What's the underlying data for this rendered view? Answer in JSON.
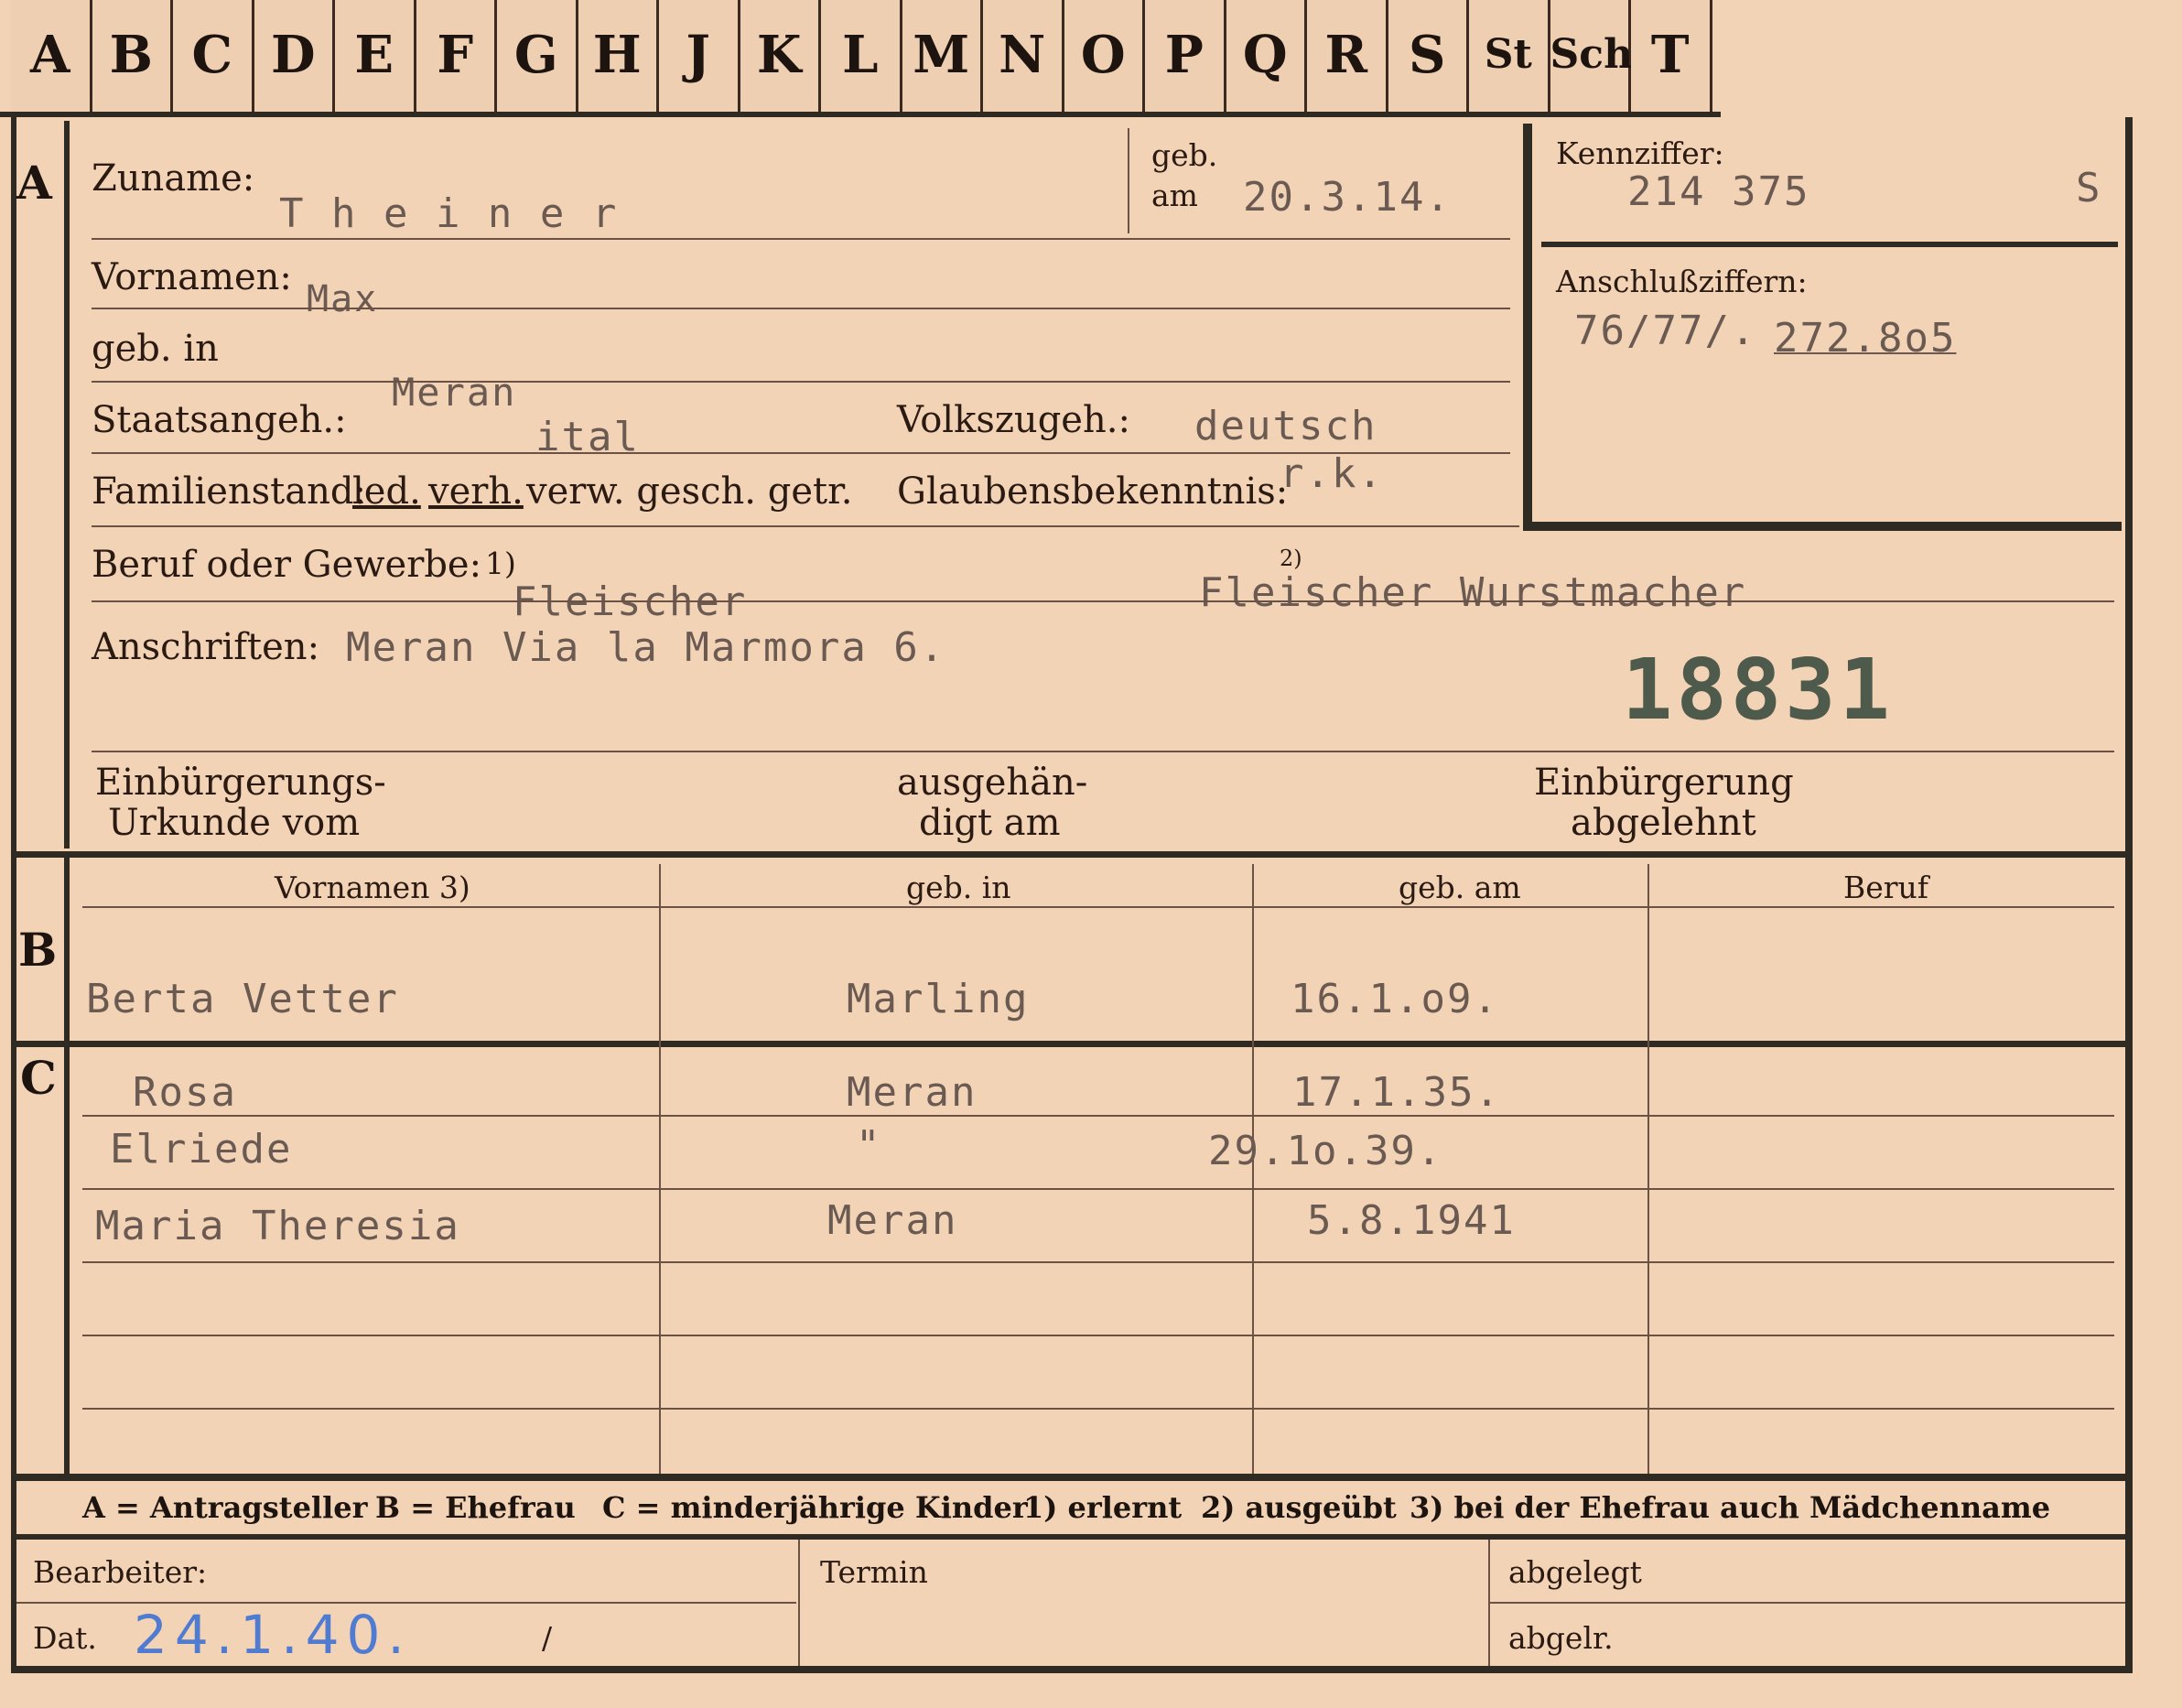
{
  "tabs": [
    "A",
    "B",
    "C",
    "D",
    "E",
    "F",
    "G",
    "H",
    "J",
    "K",
    "L",
    "M",
    "N",
    "O",
    "P",
    "Q",
    "R",
    "S",
    "St",
    "Sch",
    "T"
  ],
  "section_a": {
    "marker": "A",
    "zuname_label": "Zuname:",
    "zuname": "T h e i n e r",
    "geb_label_1": "geb.",
    "geb_label_2": "am",
    "geb_am": "20.3.14.",
    "kennziffer_label": "Kennziffer:",
    "kennziffer": "214 375",
    "kennziffer_suffix": "S",
    "vornamen_label": "Vornamen:",
    "vornamen": "Max",
    "anschluss_label": "Anschlußziffern:",
    "anschluss_1": "76/77/.",
    "anschluss_2": "272.8o5",
    "geb_in_label": "geb. in",
    "geb_in": "Meran",
    "staatsangeh_label": "Staatsangeh.:",
    "staatsangeh": "ital",
    "volkszugeh_label": "Volkszugeh.:",
    "volkszugeh": "deutsch",
    "familienstand_label": "Familienstand:",
    "familienstand_led": "led.",
    "familienstand_verh": "verh.",
    "familienstand_rest": "verw. gesch. getr.",
    "glaubens_label": "Glaubensbekenntnis:",
    "glaubens": "r.k.",
    "beruf_label": "Beruf oder Gewerbe:",
    "beruf_fn1": "1)",
    "beruf_erlernt": "Fleischer",
    "beruf_fn2": "2)",
    "beruf_ausgeuebt": "Fleischer Wurstmacher",
    "anschriften_label": "Anschriften:",
    "anschriften": "Meran Via la Marmora 6.",
    "stamp_number": "18831",
    "einb_label_1": "Einbürgerungs-",
    "einb_label_2": "Urkunde vom",
    "ausgeh_label_1": "ausgehän-",
    "ausgeh_label_2": "digt am",
    "abgelehnt_label_1": "Einbürgerung",
    "abgelehnt_label_2": "abgelehnt"
  },
  "section_b": {
    "marker": "B",
    "headers": [
      "Vornamen 3)",
      "geb. in",
      "geb. am",
      "Beruf"
    ],
    "row": {
      "vornamen": "Berta Vetter",
      "geb_in": "Marling",
      "geb_am": "16.1.o9.",
      "beruf": ""
    }
  },
  "section_c": {
    "marker": "C",
    "rows": [
      {
        "vornamen": "Rosa",
        "geb_in": "Meran",
        "geb_am": "17.1.35."
      },
      {
        "vornamen": "Elriede",
        "geb_in": "\"",
        "geb_am": "29.1o.39."
      },
      {
        "vornamen": "Maria Theresia",
        "geb_in": "Meran",
        "geb_am": "5.8.1941"
      }
    ]
  },
  "legend": {
    "a": "A = Antragsteller",
    "b": "B = Ehefrau",
    "c": "C = minderjährige Kinder",
    "n1": "1) erlernt",
    "n2": "2) ausgeübt",
    "n3": "3) bei der Ehefrau auch Mädchenname"
  },
  "footer": {
    "bearbeiter_label": "Bearbeiter:",
    "termin_label": "Termin",
    "abgelegt_label": "abgelegt",
    "dat_label": "Dat.",
    "dat_value": "24.1.40.",
    "slash": "/",
    "abgelr_label": "abgelr."
  }
}
